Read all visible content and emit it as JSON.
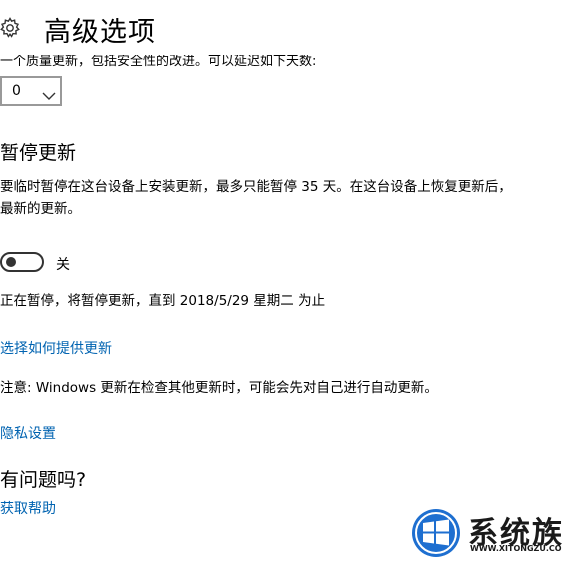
{
  "page": {
    "title": "高级选项",
    "defer_feature_text": "一个质量更新，包括安全性的改进。可以延迟如下天数:",
    "defer_days": {
      "value": "0"
    }
  },
  "pause": {
    "heading": "暂停更新",
    "description_line1": "要临时暂停在这台设备上安装更新，最多只能暂停 35 天。在这台设备上恢复更新后，",
    "description_line2": "最新的更新。",
    "toggle": {
      "state": "off",
      "label": "关"
    },
    "status": "正在暂停，将暂停更新，直到 2018/5/29 星期二 为止"
  },
  "links": {
    "choose_delivery": "选择如何提供更新",
    "privacy": "隐私设置",
    "get_help": "获取帮助"
  },
  "note": "注意: Windows 更新在检查其他更新时，可能会先对自己进行自动更新。",
  "help": {
    "heading": "有问题吗?"
  },
  "watermark": {
    "brand": "系统族",
    "url": "WWW.XITONGZU.COM"
  },
  "colors": {
    "link": "#0063b1",
    "brand_blue": "#1e6fd0"
  }
}
